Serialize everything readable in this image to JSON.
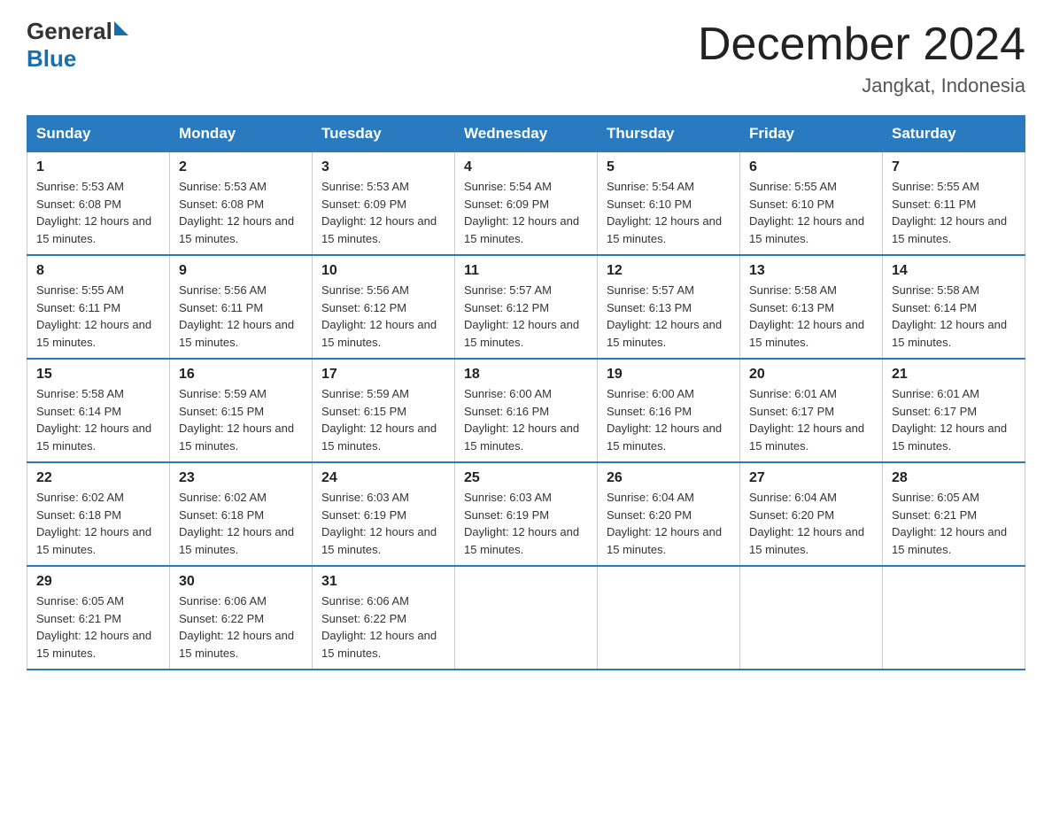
{
  "logo": {
    "general": "General",
    "blue": "Blue"
  },
  "header": {
    "month_year": "December 2024",
    "location": "Jangkat, Indonesia"
  },
  "weekdays": [
    "Sunday",
    "Monday",
    "Tuesday",
    "Wednesday",
    "Thursday",
    "Friday",
    "Saturday"
  ],
  "weeks": [
    [
      {
        "day": "1",
        "sunrise": "5:53 AM",
        "sunset": "6:08 PM",
        "daylight": "12 hours and 15 minutes."
      },
      {
        "day": "2",
        "sunrise": "5:53 AM",
        "sunset": "6:08 PM",
        "daylight": "12 hours and 15 minutes."
      },
      {
        "day": "3",
        "sunrise": "5:53 AM",
        "sunset": "6:09 PM",
        "daylight": "12 hours and 15 minutes."
      },
      {
        "day": "4",
        "sunrise": "5:54 AM",
        "sunset": "6:09 PM",
        "daylight": "12 hours and 15 minutes."
      },
      {
        "day": "5",
        "sunrise": "5:54 AM",
        "sunset": "6:10 PM",
        "daylight": "12 hours and 15 minutes."
      },
      {
        "day": "6",
        "sunrise": "5:55 AM",
        "sunset": "6:10 PM",
        "daylight": "12 hours and 15 minutes."
      },
      {
        "day": "7",
        "sunrise": "5:55 AM",
        "sunset": "6:11 PM",
        "daylight": "12 hours and 15 minutes."
      }
    ],
    [
      {
        "day": "8",
        "sunrise": "5:55 AM",
        "sunset": "6:11 PM",
        "daylight": "12 hours and 15 minutes."
      },
      {
        "day": "9",
        "sunrise": "5:56 AM",
        "sunset": "6:11 PM",
        "daylight": "12 hours and 15 minutes."
      },
      {
        "day": "10",
        "sunrise": "5:56 AM",
        "sunset": "6:12 PM",
        "daylight": "12 hours and 15 minutes."
      },
      {
        "day": "11",
        "sunrise": "5:57 AM",
        "sunset": "6:12 PM",
        "daylight": "12 hours and 15 minutes."
      },
      {
        "day": "12",
        "sunrise": "5:57 AM",
        "sunset": "6:13 PM",
        "daylight": "12 hours and 15 minutes."
      },
      {
        "day": "13",
        "sunrise": "5:58 AM",
        "sunset": "6:13 PM",
        "daylight": "12 hours and 15 minutes."
      },
      {
        "day": "14",
        "sunrise": "5:58 AM",
        "sunset": "6:14 PM",
        "daylight": "12 hours and 15 minutes."
      }
    ],
    [
      {
        "day": "15",
        "sunrise": "5:58 AM",
        "sunset": "6:14 PM",
        "daylight": "12 hours and 15 minutes."
      },
      {
        "day": "16",
        "sunrise": "5:59 AM",
        "sunset": "6:15 PM",
        "daylight": "12 hours and 15 minutes."
      },
      {
        "day": "17",
        "sunrise": "5:59 AM",
        "sunset": "6:15 PM",
        "daylight": "12 hours and 15 minutes."
      },
      {
        "day": "18",
        "sunrise": "6:00 AM",
        "sunset": "6:16 PM",
        "daylight": "12 hours and 15 minutes."
      },
      {
        "day": "19",
        "sunrise": "6:00 AM",
        "sunset": "6:16 PM",
        "daylight": "12 hours and 15 minutes."
      },
      {
        "day": "20",
        "sunrise": "6:01 AM",
        "sunset": "6:17 PM",
        "daylight": "12 hours and 15 minutes."
      },
      {
        "day": "21",
        "sunrise": "6:01 AM",
        "sunset": "6:17 PM",
        "daylight": "12 hours and 15 minutes."
      }
    ],
    [
      {
        "day": "22",
        "sunrise": "6:02 AM",
        "sunset": "6:18 PM",
        "daylight": "12 hours and 15 minutes."
      },
      {
        "day": "23",
        "sunrise": "6:02 AM",
        "sunset": "6:18 PM",
        "daylight": "12 hours and 15 minutes."
      },
      {
        "day": "24",
        "sunrise": "6:03 AM",
        "sunset": "6:19 PM",
        "daylight": "12 hours and 15 minutes."
      },
      {
        "day": "25",
        "sunrise": "6:03 AM",
        "sunset": "6:19 PM",
        "daylight": "12 hours and 15 minutes."
      },
      {
        "day": "26",
        "sunrise": "6:04 AM",
        "sunset": "6:20 PM",
        "daylight": "12 hours and 15 minutes."
      },
      {
        "day": "27",
        "sunrise": "6:04 AM",
        "sunset": "6:20 PM",
        "daylight": "12 hours and 15 minutes."
      },
      {
        "day": "28",
        "sunrise": "6:05 AM",
        "sunset": "6:21 PM",
        "daylight": "12 hours and 15 minutes."
      }
    ],
    [
      {
        "day": "29",
        "sunrise": "6:05 AM",
        "sunset": "6:21 PM",
        "daylight": "12 hours and 15 minutes."
      },
      {
        "day": "30",
        "sunrise": "6:06 AM",
        "sunset": "6:22 PM",
        "daylight": "12 hours and 15 minutes."
      },
      {
        "day": "31",
        "sunrise": "6:06 AM",
        "sunset": "6:22 PM",
        "daylight": "12 hours and 15 minutes."
      },
      null,
      null,
      null,
      null
    ]
  ]
}
